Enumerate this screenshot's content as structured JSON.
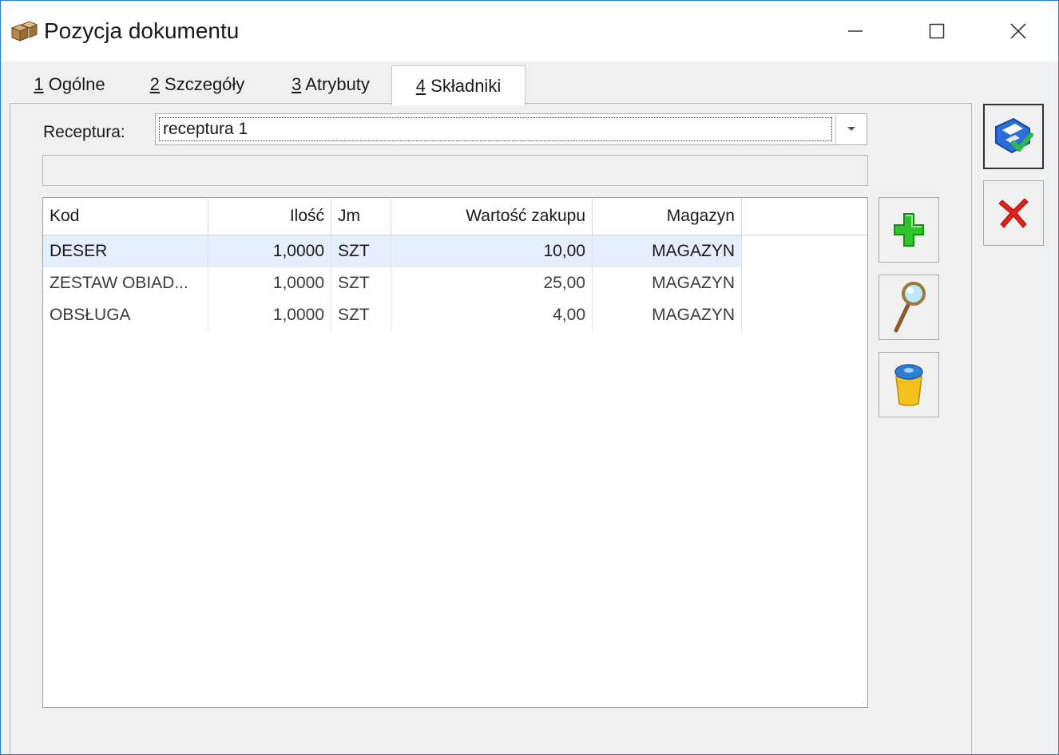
{
  "window": {
    "title": "Pozycja dokumentu"
  },
  "tabs": [
    {
      "num": "1",
      "label": " Ogólne"
    },
    {
      "num": "2",
      "label": " Szczegóły"
    },
    {
      "num": "3",
      "label": " Atrybuty"
    },
    {
      "num": "4",
      "label": " Składniki"
    }
  ],
  "active_tab": 3,
  "recipe": {
    "label": "Receptura:",
    "value": "receptura 1"
  },
  "info_bar": {
    "value": ""
  },
  "table": {
    "columns": [
      "Kod",
      "Ilość",
      "Jm",
      "Wartość zakupu",
      "Magazyn"
    ],
    "rows": [
      {
        "kod": "DESER",
        "ilosc": "1,0000",
        "jm": "SZT",
        "wartosc": "10,00",
        "magazyn": "MAGAZYN"
      },
      {
        "kod": "ZESTAW OBIAD...",
        "ilosc": "1,0000",
        "jm": "SZT",
        "wartosc": "25,00",
        "magazyn": "MAGAZYN"
      },
      {
        "kod": "OBSŁUGA",
        "ilosc": "1,0000",
        "jm": "SZT",
        "wartosc": "4,00",
        "magazyn": "MAGAZYN"
      }
    ]
  },
  "buttons": {
    "save": "save-icon",
    "cancel": "cancel-icon",
    "add": "plus-icon",
    "preview": "magnifier-icon",
    "delete": "trash-icon"
  },
  "colors": {
    "accent": "#2b79d6",
    "selected_row": "#e5eefc",
    "add_green": "#2fc42a",
    "cancel_red": "#e2201c"
  }
}
